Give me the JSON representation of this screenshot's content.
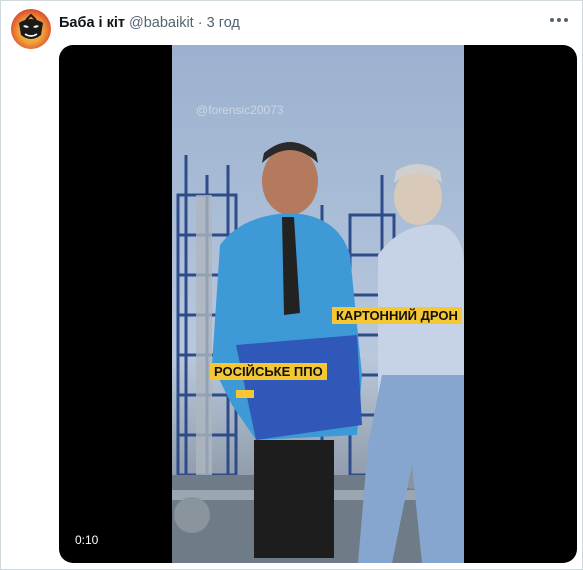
{
  "tweet": {
    "display_name": "Баба і кіт",
    "handle": "@babaikit",
    "separator": "·",
    "time": "3 год",
    "more_icon": "more-horizontal-icon",
    "avatar_icon": "mask-avatar"
  },
  "video": {
    "watermark": "@forensic20073",
    "caption_drone": "КАРТОННИЙ ДРОН",
    "caption_ppo": "РОСІЙСЬКЕ ППО",
    "duration": "0:10"
  },
  "colors": {
    "caption_bg": "#f4c733",
    "border": "#cfd9de",
    "secondary_text": "#536471"
  }
}
